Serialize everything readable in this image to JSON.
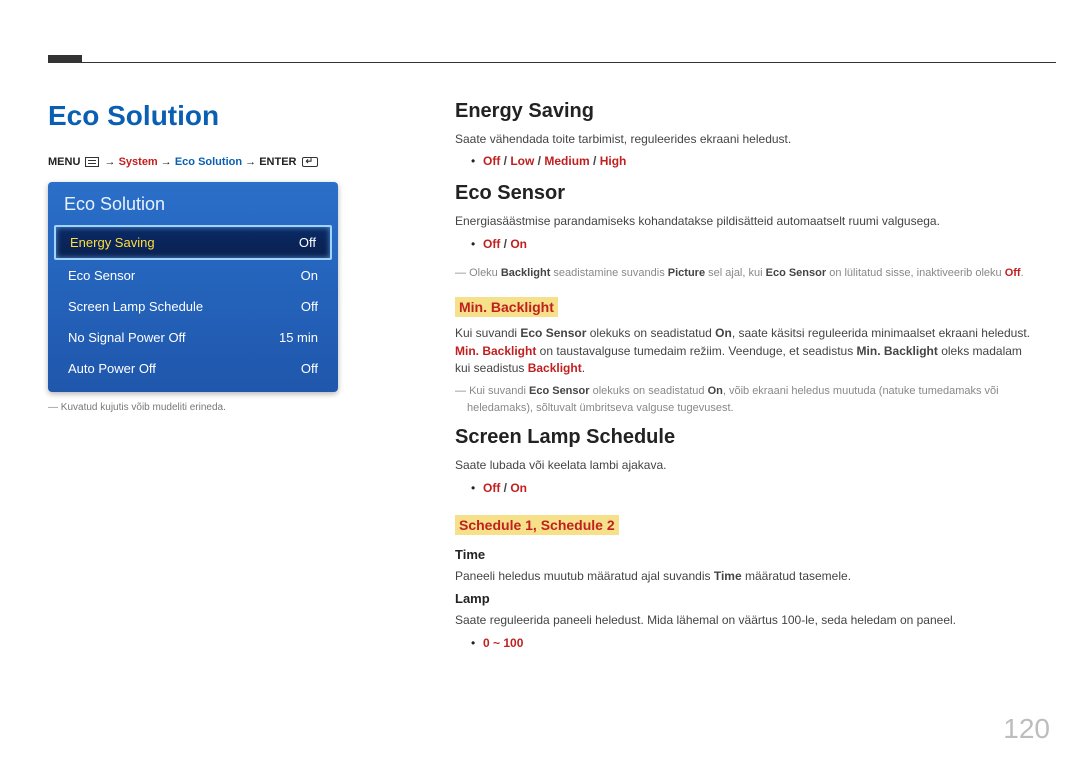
{
  "page_title": "Eco Solution",
  "breadcrumb": {
    "menu_label": "MENU",
    "arrow": "→",
    "system": "System",
    "eco": "Eco Solution",
    "enter": "ENTER"
  },
  "osd": {
    "title": "Eco Solution",
    "rows": [
      {
        "label": "Energy Saving",
        "value": "Off",
        "selected": true
      },
      {
        "label": "Eco Sensor",
        "value": "On",
        "selected": false
      },
      {
        "label": "Screen Lamp Schedule",
        "value": "Off",
        "selected": false
      },
      {
        "label": "No Signal Power Off",
        "value": "15 min",
        "selected": false
      },
      {
        "label": "Auto Power Off",
        "value": "Off",
        "selected": false
      }
    ]
  },
  "footnote": "Kuvatud kujutis võib mudeliti erineda.",
  "sections": {
    "energy_saving": {
      "title": "Energy Saving",
      "desc": "Saate vähendada toite tarbimist, reguleerides ekraani heledust.",
      "options": [
        "Off",
        "Low",
        "Medium",
        "High"
      ]
    },
    "eco_sensor": {
      "title": "Eco Sensor",
      "desc": "Energiasäästmise parandamiseks kohandatakse pildisätteid automaatselt ruumi valgusega.",
      "options": [
        "Off",
        "On"
      ],
      "note1_pre": "Oleku ",
      "note1_b1": "Backlight",
      "note1_mid1": " seadistamine suvandis ",
      "note1_b2": "Picture",
      "note1_mid2": " sel ajal, kui ",
      "note1_b3": "Eco Sensor",
      "note1_mid3": " on lülitatud sisse, inaktiveerib oleku ",
      "note1_b4": "Off",
      "note1_end": ".",
      "min_backlight": {
        "title": "Min. Backlight",
        "desc_pre": "Kui suvandi ",
        "desc_b1": "Eco Sensor",
        "desc_mid1": " olekuks on seadistatud ",
        "desc_b2": "On",
        "desc_mid2": ", saate käsitsi reguleerida minimaalset ekraani heledust. ",
        "desc_b3": "Min. Backlight",
        "desc_mid3": " on taustavalguse tumedaim režiim. Veenduge, et seadistus ",
        "desc_b4": "Min. Backlight",
        "desc_mid4": " oleks madalam kui seadistus ",
        "desc_b5": "Backlight",
        "desc_end": ".",
        "note_pre": "Kui suvandi ",
        "note_b1": "Eco Sensor",
        "note_mid1": " olekuks on seadistatud ",
        "note_b2": "On",
        "note_end": ", võib ekraani heledus muutuda (natuke tumedamaks või heledamaks), sõltuvalt ümbritseva valguse tugevusest."
      }
    },
    "lamp_schedule": {
      "title": "Screen Lamp Schedule",
      "desc": "Saate lubada või keelata lambi ajakava.",
      "options": [
        "Off",
        "On"
      ],
      "sub_title": "Schedule 1, Schedule 2",
      "time": {
        "title": "Time",
        "desc_pre": "Paneeli heledus muutub määratud ajal suvandis ",
        "desc_b": "Time",
        "desc_end": " määratud tasemele."
      },
      "lamp": {
        "title": "Lamp",
        "desc": "Saate reguleerida paneeli heledust. Mida lähemal on väärtus 100-le, seda heledam on paneel.",
        "range": "0 ~ 100"
      }
    }
  },
  "page_number": "120"
}
